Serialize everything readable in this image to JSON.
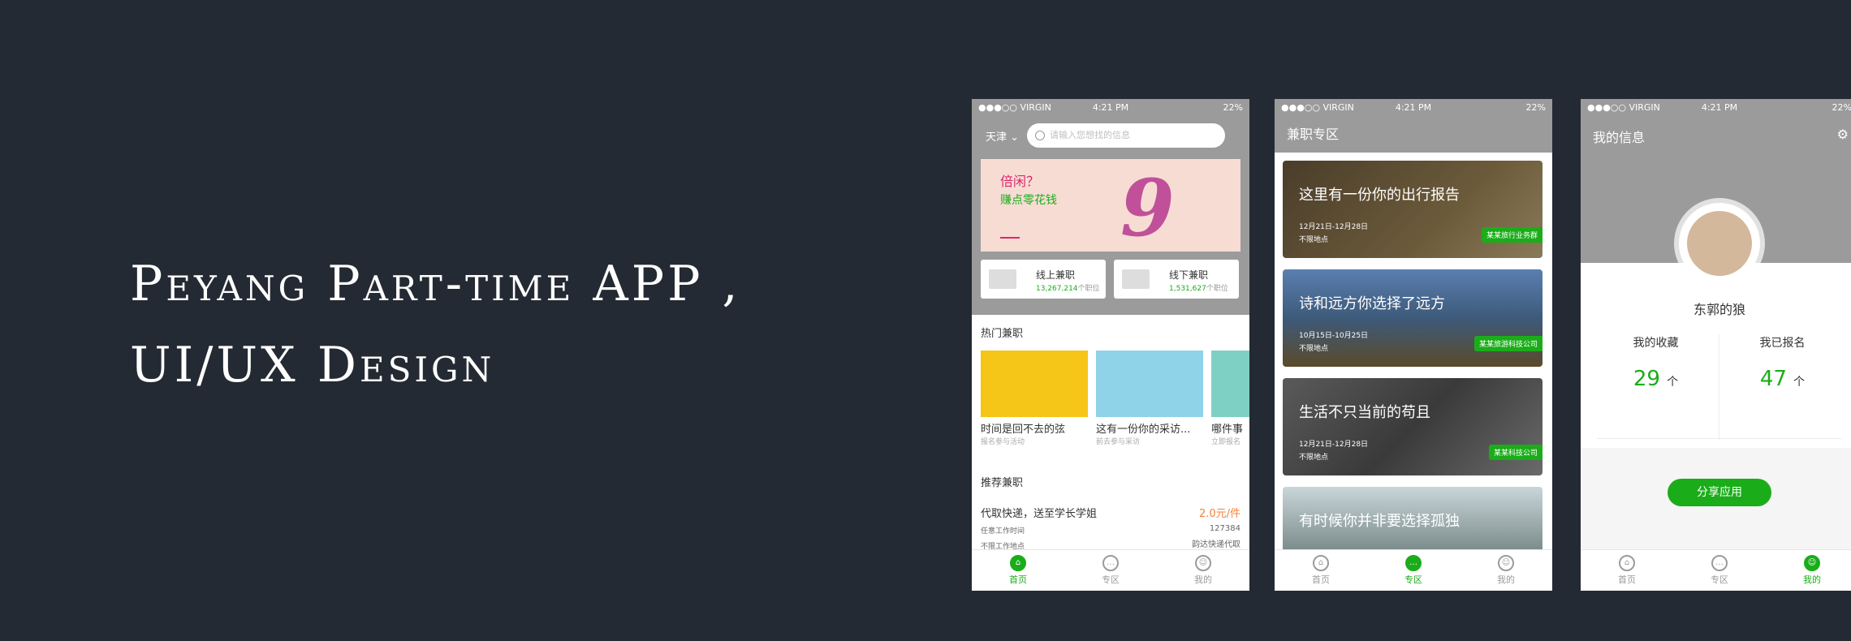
{
  "hero": {
    "line1": "Peyang Part-time APP ,",
    "line2": "UI/UX Design"
  },
  "status_bar": {
    "carrier": "●●●○○ VIRGIN",
    "time": "4:21 PM",
    "battery": "22%"
  },
  "tabbar": {
    "home": "首页",
    "zone": "专区",
    "mine": "我的"
  },
  "phone1": {
    "city": "天津 ⌄",
    "search_placeholder": "请输入您想找的信息",
    "banner": {
      "line1": "倍闲？",
      "line2": "赚点零花钱",
      "number": "9"
    },
    "online": {
      "title": "线上兼职",
      "count": "13,267,214",
      "unit": "个职位"
    },
    "offline": {
      "title": "线下兼职",
      "count": "1,531,627",
      "unit": "个职位"
    },
    "hot_title": "热门兼职",
    "hot_items": [
      {
        "title": "时间是回不去的弦",
        "sub": "报名参与活动"
      },
      {
        "title": "这有一份你的采访...",
        "sub": "前去参与采访"
      },
      {
        "title": "哪件事",
        "sub": "立即报名"
      }
    ],
    "recommend_title": "推荐兼职",
    "recommend": {
      "title": "代取快递，送至学长学姐",
      "price": "2.0元/件",
      "time": "任意工作时间",
      "place": "不限工作地点",
      "views": "127384",
      "company": "韵达快递代取"
    }
  },
  "phone2": {
    "title": "兼职专区",
    "cards": [
      {
        "title": "这里有一份你的出行报告",
        "date": "12月21日-12月28日",
        "place": "不限地点",
        "badge": "某某旅行业务群"
      },
      {
        "title": "诗和远方你选择了远方",
        "date": "10月15日-10月25日",
        "place": "不限地点",
        "badge": "某某旅游科技公司"
      },
      {
        "title": "生活不只当前的苟且",
        "date": "12月21日-12月28日",
        "place": "不限地点",
        "badge": "某某科技公司"
      },
      {
        "title": "有时候你并非要选择孤独",
        "date": "",
        "place": "",
        "badge": ""
      }
    ]
  },
  "phone3": {
    "title": "我的信息",
    "username": "东郭的狼",
    "fav_label": "我的收藏",
    "fav_value": "29",
    "fav_unit": "个",
    "applied_label": "我已报名",
    "applied_value": "47",
    "applied_unit": "个",
    "share": "分享应用"
  },
  "colors": {
    "background": "#242a33",
    "accent": "#1aad19",
    "header": "#9b9b9b",
    "price": "#f5813b"
  }
}
